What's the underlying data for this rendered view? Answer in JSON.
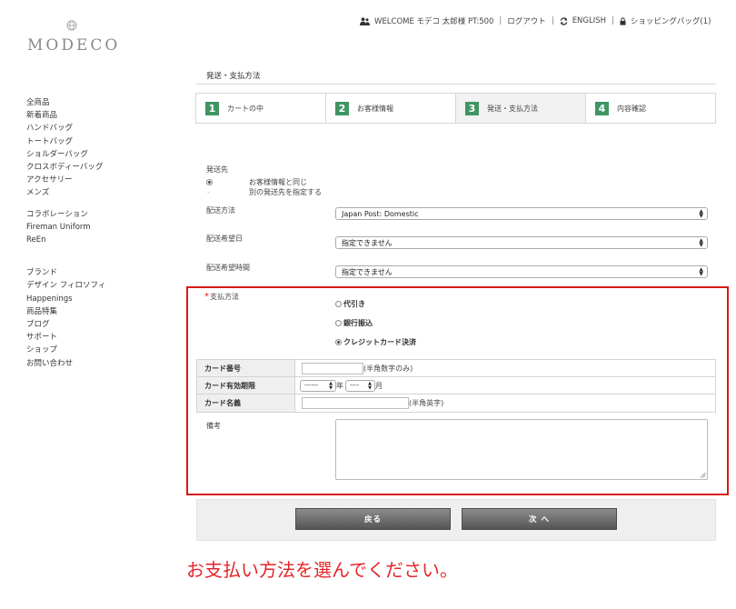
{
  "brand": {
    "name": "MODECO"
  },
  "topbar": {
    "welcome": "WELCOME モデコ 太郎様 PT:500",
    "logout": "ログアウト",
    "language": "ENGLISH",
    "cart": "ショッピングバッグ(1)"
  },
  "sidebar": {
    "group1": [
      "全商品",
      "新着商品",
      "ハンドバッグ",
      "トートバッグ",
      "ショルダーバッグ",
      "クロスボディーバッグ",
      "アクセサリー",
      "メンズ"
    ],
    "group2": [
      "コラボレーション",
      "Fireman Uniform",
      "ReEn"
    ],
    "group3": [
      "ブランド",
      "デザイン フィロソフィ",
      "Happenings",
      "商品特集",
      "ブログ",
      "サポート",
      "ショップ",
      "お問い合わせ"
    ]
  },
  "page": {
    "title": "発送・支払方法"
  },
  "steps": [
    {
      "num": "1",
      "label": "カートの中"
    },
    {
      "num": "2",
      "label": "お客様情報"
    },
    {
      "num": "3",
      "label": "発送・支払方法"
    },
    {
      "num": "4",
      "label": "内容確認"
    }
  ],
  "shipping": {
    "destination_label": "発送先",
    "option_same": "お客様情報と同じ",
    "option_other": "別の発送先を指定する",
    "method_label": "配送方法",
    "method_value": "Japan Post: Domestic",
    "date_label": "配送希望日",
    "date_value": "指定できません",
    "time_label": "配送希望時間",
    "time_value": "指定できません"
  },
  "payment": {
    "required_mark": "*",
    "label": "支払方法",
    "options": [
      "代引き",
      "銀行振込",
      "クレジットカード決済"
    ]
  },
  "card": {
    "number_label": "カード番号",
    "number_hint": "(半角数字のみ)",
    "expiry_label": "カード有効期限",
    "month_value": "------",
    "year_unit": "年",
    "day_value": "----",
    "month_unit": "月",
    "name_label": "カード名義",
    "name_hint": "(半角英字)"
  },
  "notes": {
    "label": "備考"
  },
  "buttons": {
    "back": "戻る",
    "next": "次 へ"
  },
  "instruction": "お支払い方法を選んでください。",
  "colors": {
    "step_green": "#3f9563",
    "highlight_red": "#d81818",
    "instruction_red": "#e3262a"
  }
}
